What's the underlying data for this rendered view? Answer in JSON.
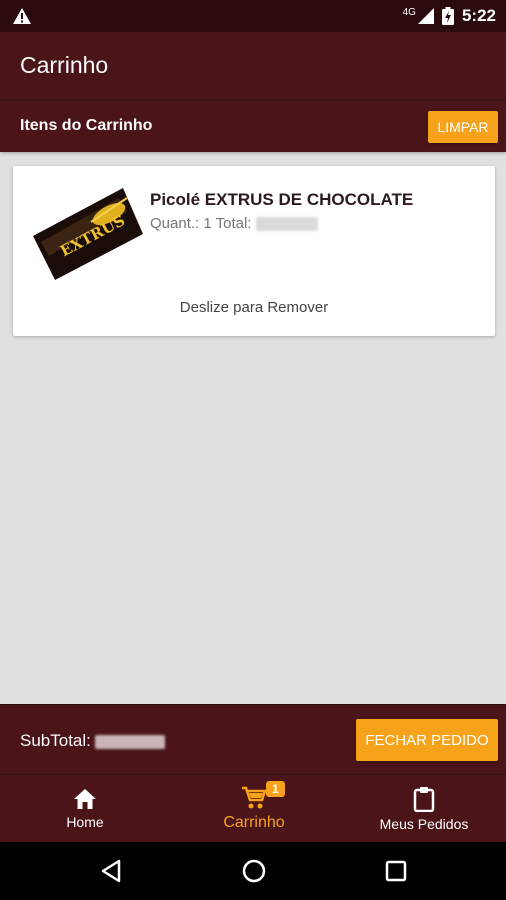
{
  "status_bar": {
    "time": "5:22",
    "network": "4G"
  },
  "app_bar": {
    "title": "Carrinho"
  },
  "cart_section": {
    "title": "Itens do Carrinho",
    "clear_label": "LIMPAR"
  },
  "cart_items": [
    {
      "name": "Picolé EXTRUS DE CHOCOLATE",
      "quantity_label": "Quant.: 1 Total:",
      "image_text": "EXTRUS",
      "swipe_hint": "Deslize para Remover"
    }
  ],
  "summary": {
    "subtotal_label": "SubTotal:",
    "close_order_label": "FECHAR PEDIDO"
  },
  "bottom_nav": {
    "home_label": "Home",
    "cart_label": "Carrinho",
    "cart_badge": "1",
    "orders_label": "Meus Pedidos"
  },
  "colors": {
    "primary": "#4a1418",
    "accent": "#f7a21b",
    "status": "#2a0a0d"
  }
}
